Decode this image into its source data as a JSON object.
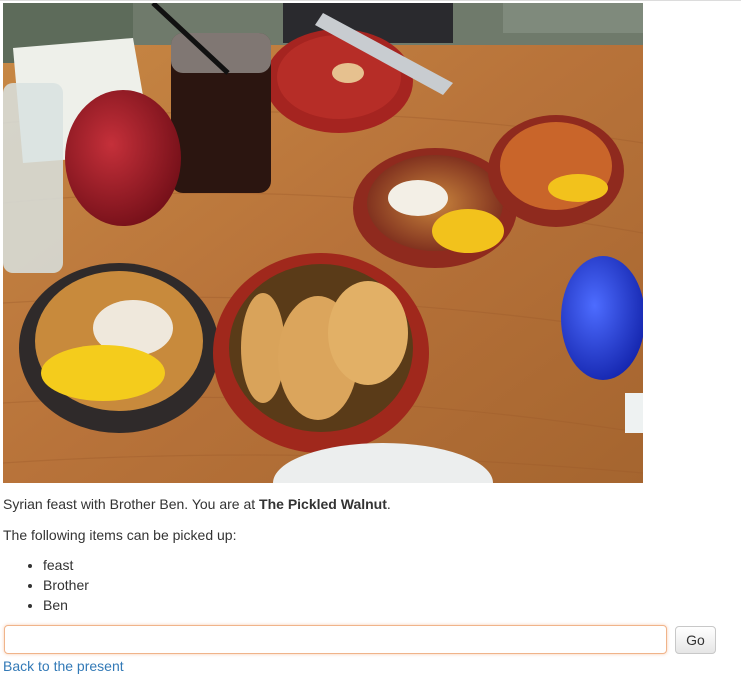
{
  "photo": {
    "description_hidden": ""
  },
  "caption": {
    "text_before": "Syrian feast with Brother Ben. You are at ",
    "location": "The Pickled Walnut",
    "text_after": "."
  },
  "pickup": {
    "intro": "The following items can be picked up:",
    "items": [
      "feast",
      "Brother",
      "Ben"
    ]
  },
  "command": {
    "value": "",
    "go_label": "Go"
  },
  "nav": {
    "back_label": "Back to the present"
  },
  "colors": {
    "link": "#337ab7",
    "input_focus_border": "#f0b48a"
  }
}
